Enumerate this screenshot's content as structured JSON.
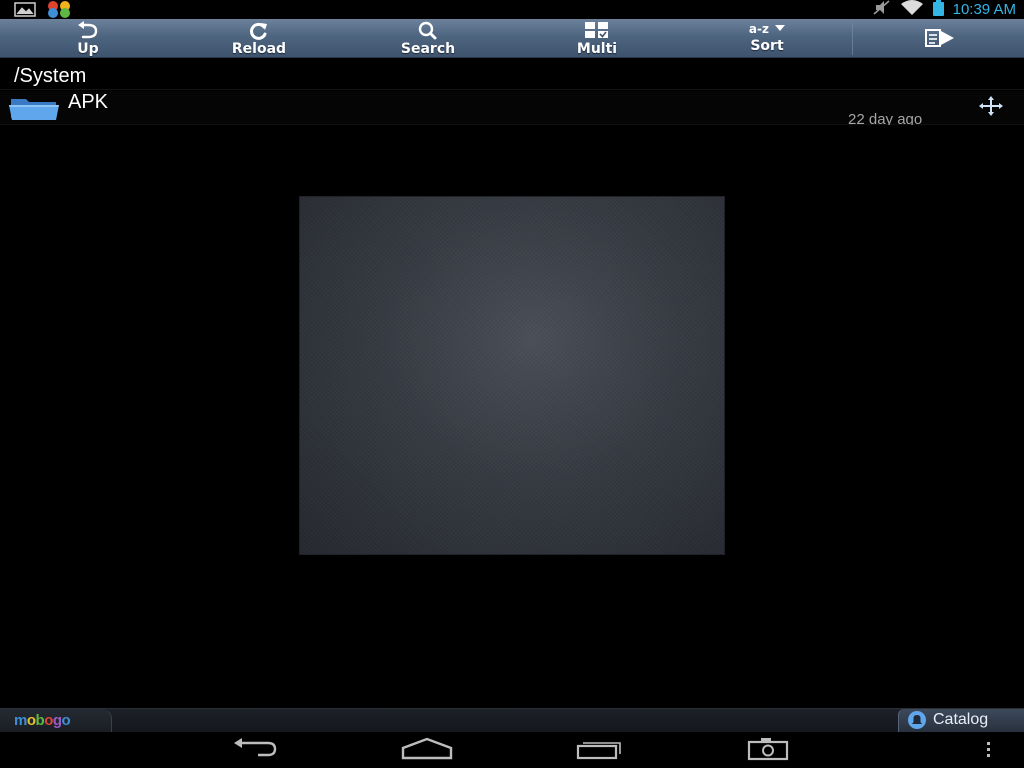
{
  "status_bar": {
    "time": "10:39 AM",
    "icons": [
      "gallery-icon",
      "pinwheel-app-icon",
      "mute-icon",
      "wifi-icon",
      "battery-icon"
    ],
    "accent_color": "#33b5e5"
  },
  "toolbar": {
    "up_label": "Up",
    "reload_label": "Reload",
    "search_label": "Search",
    "multi_label": "Multi",
    "sort_indicator": "a-z",
    "sort_label": "Sort",
    "colors": {
      "top": "#6d819b",
      "bottom": "#3e536d"
    }
  },
  "path": {
    "current": "/System"
  },
  "files": [
    {
      "name": "APK",
      "type": "folder",
      "modified": "22 day ago"
    }
  ],
  "bottom_bar": {
    "logo_letters": [
      "m",
      "o",
      "b",
      "o",
      "g",
      "o"
    ],
    "logo_colors": [
      "#3f8fd6",
      "#e8c12a",
      "#5fb844",
      "#d9463a",
      "#9b59c6",
      "#3f8fd6"
    ],
    "catalog_label": "Catalog"
  },
  "nav_bar": {
    "buttons": [
      "back-icon",
      "home-icon",
      "recent-apps-icon",
      "screenshot-icon",
      "overflow-menu-icon"
    ]
  }
}
